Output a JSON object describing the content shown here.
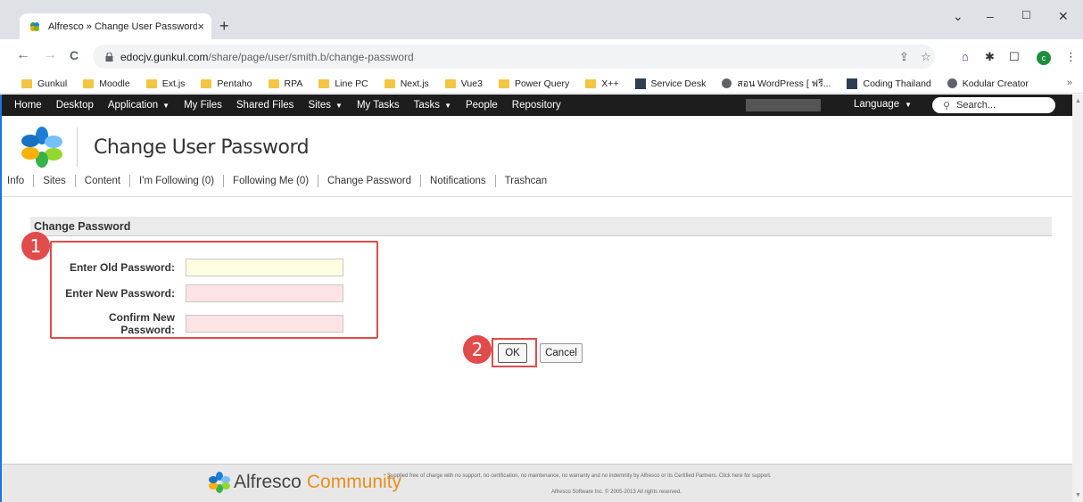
{
  "browser": {
    "tab_title": "Alfresco » Change User Password",
    "tab_close": "×",
    "new_tab": "+",
    "url_host": "edocjv.gunkul.com",
    "url_path": "/share/page/user/smith.b/change-password",
    "window_controls": {
      "chevron": "⌄",
      "minimize": "–",
      "maximize": "☐",
      "close": "✕"
    },
    "nav": {
      "back": "←",
      "forward": "→",
      "reload": "C"
    },
    "bookmarks": [
      {
        "label": "Gunkul",
        "icon": "folder-icon"
      },
      {
        "label": "Moodle",
        "icon": "folder-icon"
      },
      {
        "label": "Ext.js",
        "icon": "folder-icon"
      },
      {
        "label": "Pentaho",
        "icon": "folder-icon"
      },
      {
        "label": "RPA",
        "icon": "folder-icon"
      },
      {
        "label": "Line PC",
        "icon": "folder-icon"
      },
      {
        "label": "Next.js",
        "icon": "folder-icon"
      },
      {
        "label": "Vue3",
        "icon": "folder-icon"
      },
      {
        "label": "Power Query",
        "icon": "folder-icon"
      },
      {
        "label": "X++",
        "icon": "folder-icon"
      },
      {
        "label": "Service Desk",
        "icon": "image-icon"
      },
      {
        "label": "สอน WordPress [ ฟรี...",
        "icon": "globe-icon"
      },
      {
        "label": "Coding Thailand",
        "icon": "image-icon"
      },
      {
        "label": "Kodular Creator",
        "icon": "globe-icon"
      }
    ],
    "bookmarks_more": "»",
    "avatar_letter": "c"
  },
  "app": {
    "nav": [
      "Home",
      "Desktop",
      "Application",
      "My Files",
      "Shared Files",
      "Sites",
      "My Tasks",
      "Tasks",
      "People",
      "Repository"
    ],
    "nav_dropdown": [
      false,
      false,
      true,
      false,
      false,
      true,
      false,
      true,
      false,
      false
    ],
    "language": "Language",
    "search_placeholder": "Search...",
    "page_title": "Change User Password",
    "profile_tabs": [
      "Info",
      "Sites",
      "Content",
      "I'm Following (0)",
      "Following Me (0)",
      "Change Password",
      "Notifications",
      "Trashcan"
    ],
    "section_title": "Change Password",
    "form": {
      "old_label": "Enter Old Password:",
      "new_label": "Enter New Password:",
      "confirm_label": "Confirm New Password:"
    },
    "ok_label": "OK",
    "cancel_label": "Cancel",
    "badges": [
      "1",
      "2"
    ],
    "footer": {
      "brand": "Alfresco",
      "brand_suffix": "Community",
      "notice": "Supplied free of charge with no support, no certification, no maintenance, no warranty and no indemnity by Alfresco or its Certified Partners. Click here for support.",
      "copyright": "Alfresco Software Inc. © 2005-2013 All rights reserved."
    }
  },
  "colors": {
    "accent": "#e04b4b",
    "nav_bg": "#1d1d1d",
    "community_orange": "#e88f20"
  }
}
